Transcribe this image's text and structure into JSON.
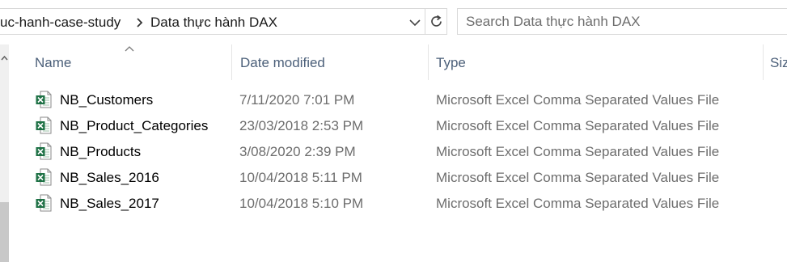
{
  "breadcrumb": {
    "parent": "uc-hanh-case-study",
    "current": "Data thực hành DAX"
  },
  "search": {
    "placeholder": "Search Data thực hành DAX"
  },
  "columns": {
    "name": "Name",
    "date": "Date modified",
    "type": "Type",
    "size": "Siz"
  },
  "files": [
    {
      "name": "NB_Customers",
      "date": "7/11/2020 7:01 PM",
      "type": "Microsoft Excel Comma Separated Values File"
    },
    {
      "name": "NB_Product_Categories",
      "date": "23/03/2018 2:53 PM",
      "type": "Microsoft Excel Comma Separated Values File"
    },
    {
      "name": "NB_Products",
      "date": "3/08/2020 2:39 PM",
      "type": "Microsoft Excel Comma Separated Values File"
    },
    {
      "name": "NB_Sales_2016",
      "date": "10/04/2018 5:11 PM",
      "type": "Microsoft Excel Comma Separated Values File"
    },
    {
      "name": "NB_Sales_2017",
      "date": "10/04/2018 5:10 PM",
      "type": "Microsoft Excel Comma Separated Values File"
    }
  ],
  "icons": {
    "file": "excel-csv-icon",
    "separator": "chevron-right-icon",
    "dropdown": "chevron-down-icon",
    "refresh": "refresh-icon",
    "sort": "sort-ascending-icon"
  },
  "colors": {
    "header_text": "#4c607a",
    "secondary_text": "#6d6d6d",
    "excel_green": "#1e7145"
  }
}
